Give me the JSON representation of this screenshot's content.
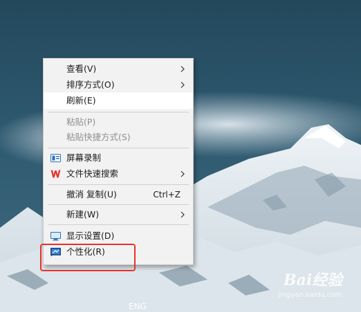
{
  "context_menu": {
    "items": [
      {
        "label": "查看(V)",
        "submenu": true
      },
      {
        "label": "排序方式(O)",
        "submenu": true
      },
      {
        "label": "刷新(E)",
        "highlighted": true
      },
      {
        "label": "粘贴(P)",
        "disabled": true
      },
      {
        "label": "粘贴快捷方式(S)",
        "disabled": true
      },
      {
        "label": "屏幕录制",
        "icon": "screen-record-icon"
      },
      {
        "label": "文件快速搜索",
        "icon": "wps-icon",
        "submenu": true
      },
      {
        "label": "撤消 复制(U)",
        "shortcut": "Ctrl+Z"
      },
      {
        "label": "新建(W)",
        "submenu": true
      },
      {
        "label": "显示设置(D)",
        "icon": "display-settings-icon"
      },
      {
        "label": "个性化(R)",
        "icon": "personalize-icon"
      }
    ]
  },
  "taskbar": {
    "language": "ENG"
  },
  "watermark": {
    "brand": "Bai经验",
    "url": "jingyan.baidu.com"
  },
  "colors": {
    "annotation_box": "#e8312a",
    "menu_bg": "#f2f2f2",
    "highlight_bg": "#ffffff"
  }
}
